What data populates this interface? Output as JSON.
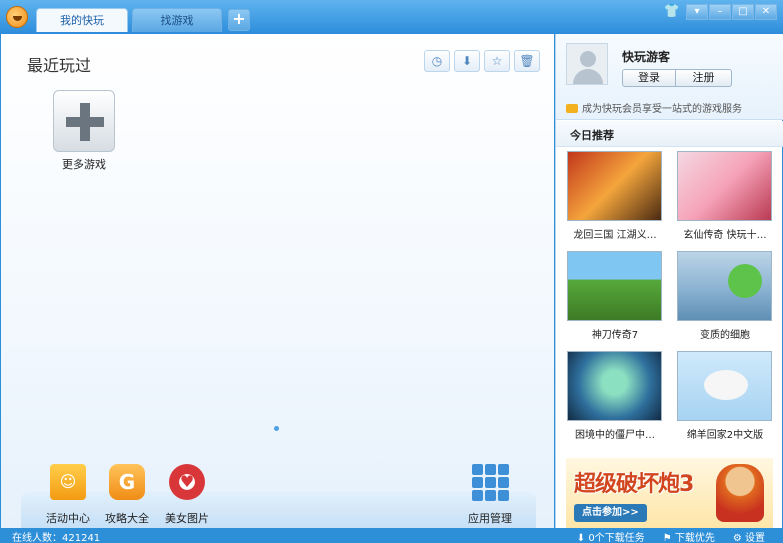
{
  "tabs": [
    {
      "label": "我的快玩"
    },
    {
      "label": "找游戏"
    }
  ],
  "add_tab_label": "+",
  "window_controls": [
    "skin-icon",
    "dropdown-icon",
    "minimize-icon",
    "maximize-icon",
    "close-icon"
  ],
  "main": {
    "section_title": "最近玩过",
    "toolbar_icons": [
      "clock-icon",
      "download-icon",
      "star-icon",
      "trash-icon"
    ],
    "more_games_label": "更多游戏",
    "dock": [
      {
        "label": "活动中心",
        "icon": "gift-icon"
      },
      {
        "label": "攻略大全",
        "icon": "guide-icon"
      },
      {
        "label": "美女图片",
        "icon": "heart-icon"
      }
    ],
    "apps_label": "应用管理"
  },
  "sidebar": {
    "username": "快玩游客",
    "login_label": "登录",
    "register_label": "注册",
    "vip_text": "成为快玩会员享受一站式的游戏服务",
    "recommend_title": "今日推荐",
    "games": [
      {
        "name": "龙回三国"
      },
      {
        "name": "江湖义…"
      },
      {
        "name": "玄仙传奇"
      },
      {
        "name": "快玩十…"
      },
      {
        "name": "神刀传奇7"
      },
      {
        "name": "变质的细胞"
      },
      {
        "name": "困境中的僵尸中…"
      },
      {
        "name": "绵羊回家2中文版"
      }
    ],
    "ad": {
      "title": "超级破坏炮3",
      "button": "点击参加>>"
    }
  },
  "status": {
    "online": "在线人数：421241",
    "downloads": "0个下载任务",
    "speed": "下载优先",
    "settings": "设置"
  }
}
